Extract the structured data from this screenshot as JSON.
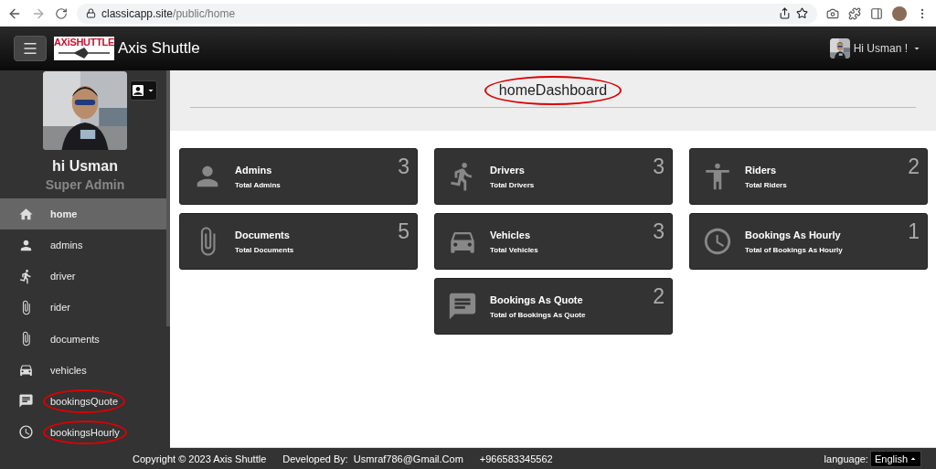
{
  "browser": {
    "url_host": "classicapp.site",
    "url_path": "/public/home"
  },
  "header": {
    "logo_text": "AXiSHUTTLE",
    "title": "Axis Shuttle",
    "user_label": "Hi Usman !"
  },
  "sidebar": {
    "greeting": "hi Usman",
    "role": "Super Admin",
    "items": [
      {
        "label": "home",
        "kind": "home",
        "selected": true,
        "circled": false
      },
      {
        "label": "admins",
        "kind": "person",
        "selected": false,
        "circled": false
      },
      {
        "label": "driver",
        "kind": "run",
        "selected": false,
        "circled": false
      },
      {
        "label": "rider",
        "kind": "clip",
        "selected": false,
        "circled": false
      },
      {
        "label": "documents",
        "kind": "clip",
        "selected": false,
        "circled": false
      },
      {
        "label": "vehicles",
        "kind": "car",
        "selected": false,
        "circled": false
      },
      {
        "label": "bookingsQuote",
        "kind": "chat",
        "selected": false,
        "circled": true
      },
      {
        "label": "bookingsHourly",
        "kind": "clock",
        "selected": false,
        "circled": true
      }
    ]
  },
  "dashboard": {
    "title": "homeDashboard",
    "title_circled": true,
    "cards": [
      {
        "title": "Admins",
        "subtitle": "Total Admins",
        "count": "3",
        "kind": "person"
      },
      {
        "title": "Drivers",
        "subtitle": "Total Drivers",
        "count": "3",
        "kind": "run"
      },
      {
        "title": "Riders",
        "subtitle": "Total Riders",
        "count": "2",
        "kind": "stand"
      },
      {
        "title": "Documents",
        "subtitle": "Total Documents",
        "count": "5",
        "kind": "clip"
      },
      {
        "title": "Vehicles",
        "subtitle": "Total Vehicles",
        "count": "3",
        "kind": "car"
      },
      {
        "title": "Bookings As Hourly",
        "subtitle": "Total of Bookings As Hourly",
        "count": "1",
        "kind": "clock"
      },
      {
        "title": "Bookings As Quote",
        "subtitle": "Total of Bookings As Quote",
        "count": "2",
        "kind": "chat"
      }
    ]
  },
  "footer": {
    "copyright": "Copyright © 2023 Axis Shuttle",
    "developed_label": "Developed By:",
    "email": "Usmraf786@Gmail.Com",
    "phone": "+966583345562",
    "language_label": "language:",
    "language": "English"
  }
}
